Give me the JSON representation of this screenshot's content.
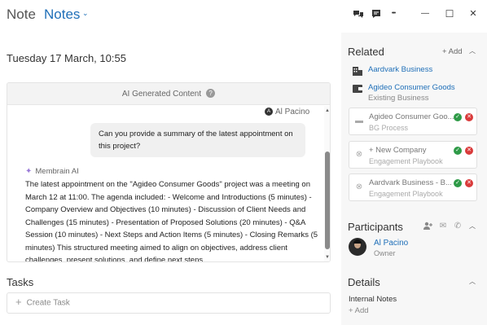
{
  "window": {
    "title_prefix": "Note",
    "title": "Notes",
    "title_caret": "⌄",
    "icons": [
      "chat-bubbles-icon",
      "message-icon",
      "more-icon",
      "minimize-icon",
      "maximize-icon",
      "close-icon"
    ],
    "glyphs": {
      "more": "•••",
      "minimize": "—",
      "maximize": "☐",
      "close": "✕"
    }
  },
  "note": {
    "date": "Tuesday 17 March, 10:55"
  },
  "ai": {
    "header": "AI Generated Content",
    "help_glyph": "?",
    "user_initial": "A",
    "user_name": "Al Pacino",
    "question": "Can you provide a summary of the latest appointment on this project?",
    "assistant_name": "Membrain AI",
    "assistant_glyph": "✦",
    "answer": "The latest appointment on the \"Agideo Consumer Goods\" project was a meeting on March 12 at 11:00. The agenda included: - Welcome and Introductions (5 minutes) - Company Overview and Objectives (10 minutes) - Discussion of Client Needs and Challenges (15 minutes) - Presentation of Proposed Solutions (20 minutes) - Q&A Session (10 minutes) - Next Steps and Action Items (5 minutes) - Closing Remarks (5 minutes) This structured meeting aimed to align on objectives, address client challenges, present solutions, and define next steps."
  },
  "tasks": {
    "title": "Tasks",
    "create_label": "Create Task",
    "plus_glyph": "+"
  },
  "related": {
    "title": "Related",
    "add_label": "+ Add",
    "items": [
      {
        "label": "Aardvark Business",
        "sub": "",
        "icon": "building-icon"
      },
      {
        "label": "Agideo Consumer Goods",
        "sub": "Existing Business",
        "icon": "wallet-icon"
      }
    ],
    "cards": [
      {
        "title": "Agideo Consumer Goo...",
        "sub": "BG Process",
        "icon": "briefcase-icon",
        "glyph": "▬"
      },
      {
        "title": "+ New Company",
        "sub": "Engagement Playbook",
        "icon": "binoculars-icon",
        "glyph": "⊗"
      },
      {
        "title": "Aardvark Business - B...",
        "sub": "Engagement Playbook",
        "icon": "binoculars-icon",
        "glyph": "⊗"
      }
    ],
    "ok_glyph": "✓",
    "remove_glyph": "✕"
  },
  "participants": {
    "title": "Participants",
    "icons": [
      "add-person-icon",
      "envelope-icon",
      "phone-icon"
    ],
    "glyphs": {
      "add": "👤",
      "mail": "✉",
      "phone": "✆"
    },
    "people": [
      {
        "name": "Al Pacino",
        "role": "Owner"
      }
    ]
  },
  "details": {
    "title": "Details",
    "internal_notes_label": "Internal Notes",
    "add_label": "+ Add"
  },
  "chevron_glyph": "︿",
  "colors": {
    "accent": "#1f6fb8",
    "ok": "#2e9a47",
    "remove": "#d93b3b",
    "panel_bg": "#f7f7f7"
  }
}
